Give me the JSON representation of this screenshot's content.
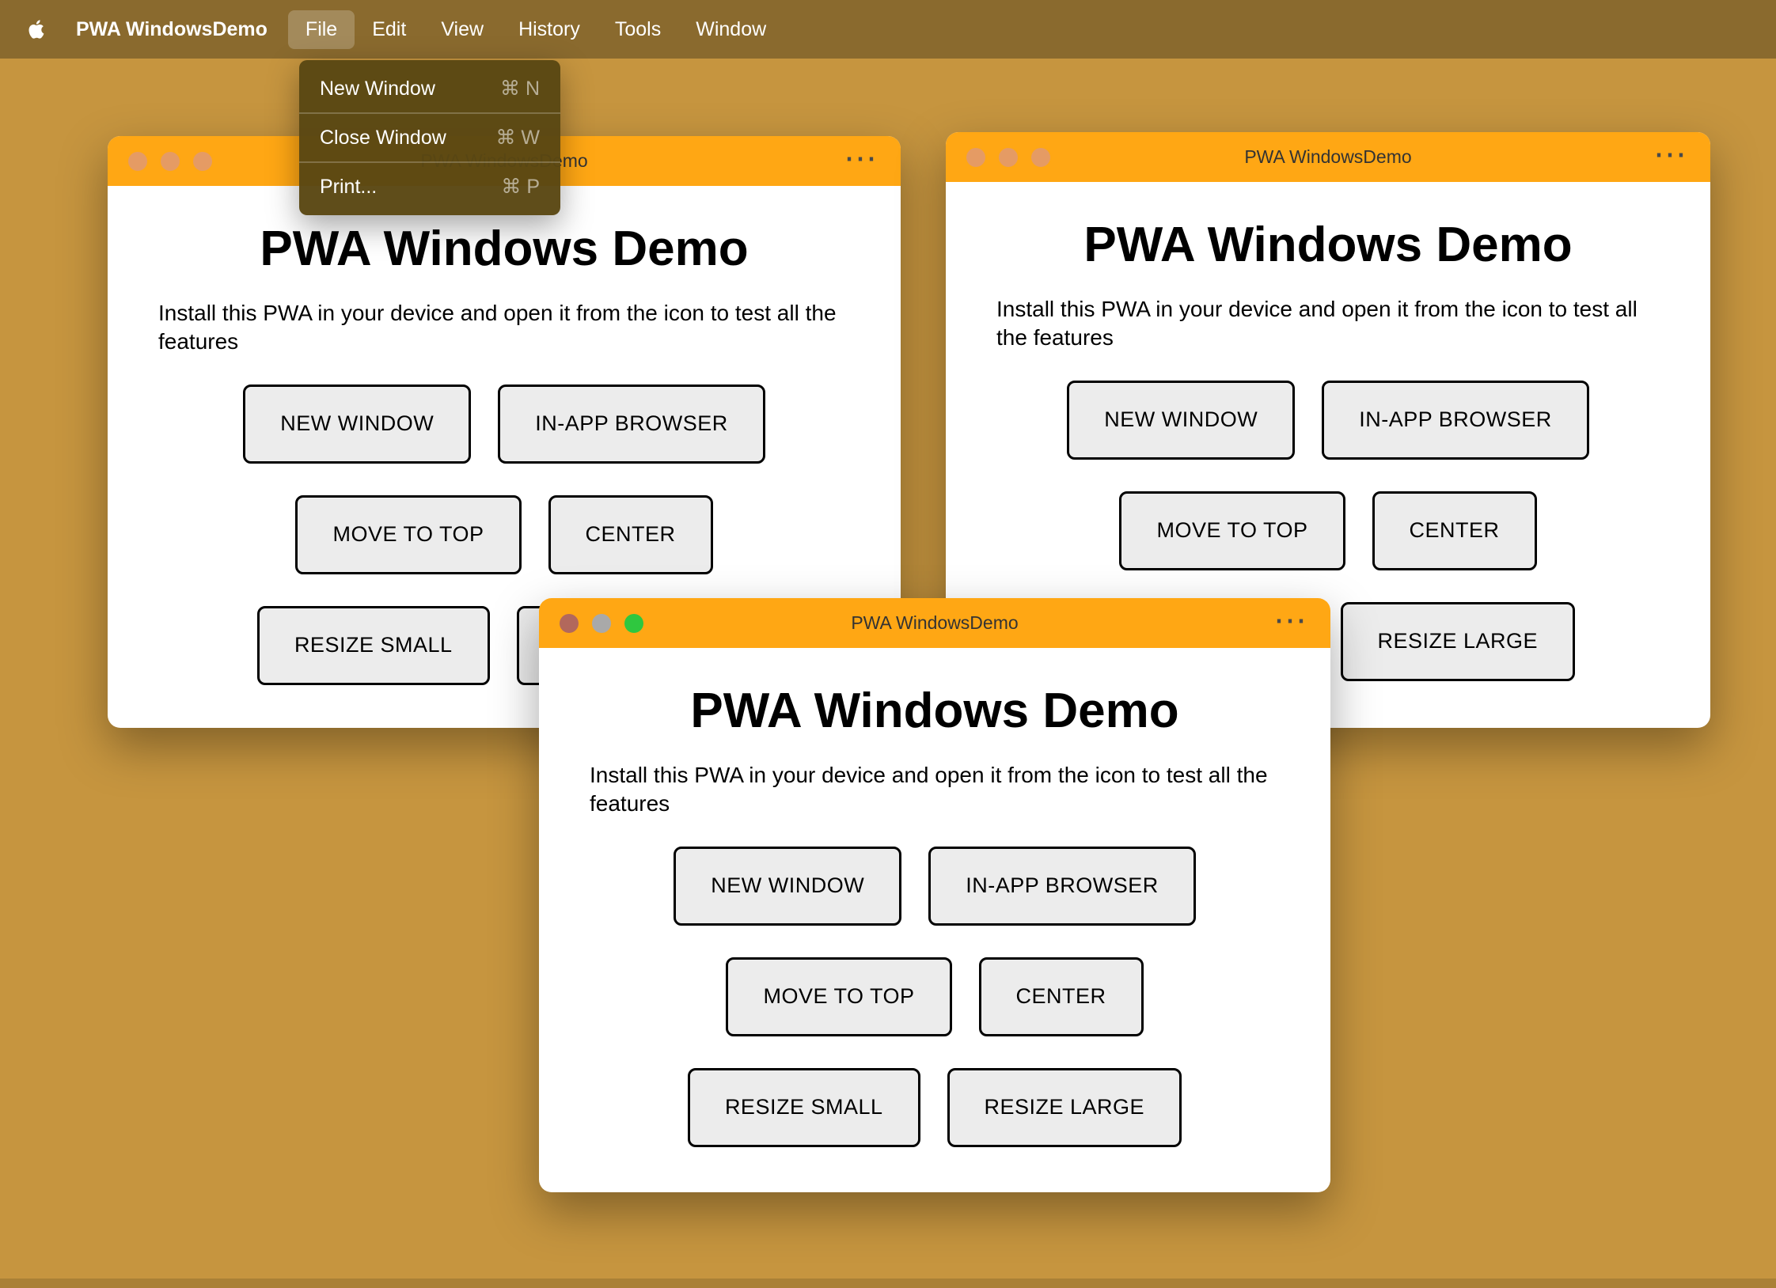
{
  "colors": {
    "desktop": "#c6953f",
    "menubar_bg": "#8a6a2e",
    "menu_highlight": "rgba(255,255,255,0.22)",
    "dropdown_bg": "rgba(90,71,19,0.97)",
    "titlebar": "#ffa714",
    "window_bg": "#ffffff",
    "button_bg": "#ececec",
    "button_border": "#000000",
    "inactive_traffic_light": "#e59b64",
    "active_traffic_lights": {
      "red": "#b2685c",
      "yellow": "#a9a9a9",
      "green": "#2fc73f"
    }
  },
  "menubar": {
    "app_name": "PWA WindowsDemo",
    "menus": [
      "File",
      "Edit",
      "View",
      "History",
      "Tools",
      "Window"
    ]
  },
  "file_menu": {
    "items": [
      {
        "label": "New Window",
        "shortcut": "⌘ N"
      },
      {
        "label": "Close Window",
        "shortcut": "⌘ W"
      },
      {
        "label": "Print...",
        "shortcut": "⌘ P"
      }
    ]
  },
  "window": {
    "title": "PWA WindowsDemo",
    "ellipsis_menu": "⋯",
    "heading": "PWA Windows Demo",
    "description": "Install this PWA in your device and open it from the icon to test all the features",
    "buttons": [
      "NEW WINDOW",
      "IN-APP BROWSER",
      "MOVE TO TOP",
      "CENTER",
      "RESIZE SMALL",
      "RESIZE LARGE"
    ]
  }
}
